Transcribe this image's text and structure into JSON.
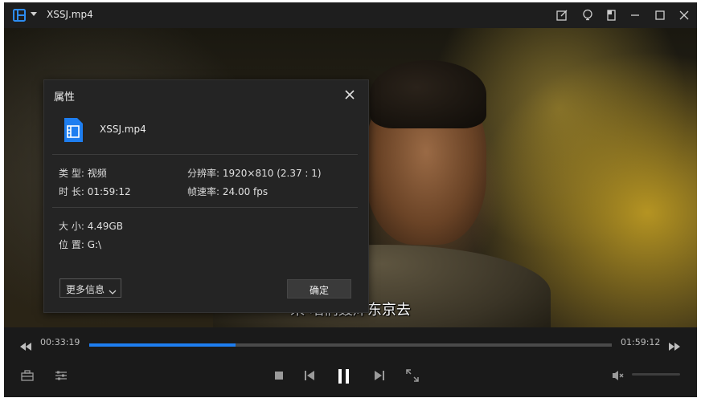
{
  "window": {
    "title": "XSSJ.mp4"
  },
  "titlebar_buttons": [
    "edit-icon",
    "bulb-icon",
    "pip-icon",
    "minimize-icon",
    "maximize-icon",
    "close-icon"
  ],
  "video": {
    "subtitle": "来 咱们轰炸东京去"
  },
  "playback": {
    "current_time": "00:33:19",
    "duration": "01:59:12",
    "progress": 0.28
  },
  "dialog": {
    "title": "属性",
    "file_name": "XSSJ.mp4",
    "props": {
      "type_label": "类 型:",
      "type_value": "视频",
      "length_label": "时 长:",
      "length_value": "01:59:12",
      "resolution_label": "分辨率:",
      "resolution_value": "1920×810 (2.37 : 1)",
      "framerate_label": "帧速率:",
      "framerate_value": "24.00 fps",
      "size_label": "大 小:",
      "size_value": "4.49GB",
      "location_label": "位 置:",
      "location_value": "G:\\"
    },
    "more_info_label": "更多信息",
    "ok_label": "确定"
  },
  "colors": {
    "accent": "#1e7ef0",
    "background": "#1b1b1b",
    "dialog": "#242424"
  }
}
